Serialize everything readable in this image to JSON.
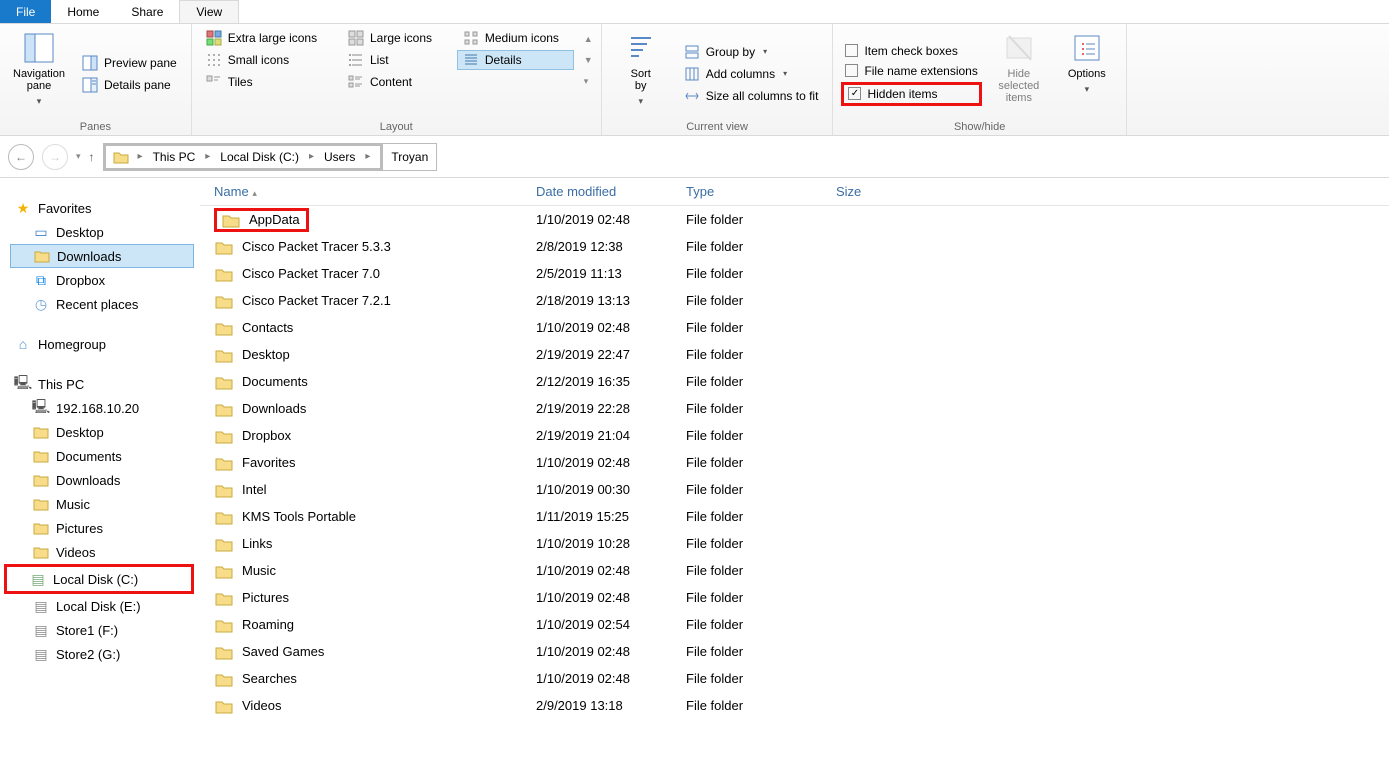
{
  "tabs": {
    "file": "File",
    "home": "Home",
    "share": "Share",
    "view": "View"
  },
  "ribbon": {
    "panes": {
      "nav": "Navigation\npane",
      "preview": "Preview pane",
      "details": "Details pane",
      "label": "Panes"
    },
    "layout": {
      "xl": "Extra large icons",
      "large": "Large icons",
      "medium": "Medium icons",
      "small": "Small icons",
      "list": "List",
      "details_item": "Details",
      "tiles": "Tiles",
      "content": "Content",
      "label": "Layout"
    },
    "current": {
      "sort": "Sort\nby",
      "group": "Group by",
      "addcols": "Add columns",
      "sizecols": "Size all columns to fit",
      "label": "Current view"
    },
    "showhide": {
      "itemchk": "Item check boxes",
      "ext": "File name extensions",
      "hidden": "Hidden items",
      "hidesel": "Hide selected\nitems",
      "options": "Options",
      "label": "Show/hide"
    }
  },
  "breadcrumb": {
    "pc": "This PC",
    "drive": "Local Disk (C:)",
    "users": "Users",
    "user": "Troyan"
  },
  "sidebar": {
    "favorites": "Favorites",
    "desktop": "Desktop",
    "downloads": "Downloads",
    "dropbox": "Dropbox",
    "recent": "Recent places",
    "homegroup": "Homegroup",
    "thispc": "This PC",
    "nas": "192.168.10.20",
    "desktop2": "Desktop",
    "documents": "Documents",
    "downloads2": "Downloads",
    "music": "Music",
    "pictures": "Pictures",
    "videos": "Videos",
    "c": "Local Disk (C:)",
    "e": "Local Disk (E:)",
    "f": "Store1 (F:)",
    "g": "Store2 (G:)"
  },
  "columns": {
    "name": "Name",
    "date": "Date modified",
    "type": "Type",
    "size": "Size"
  },
  "files": [
    {
      "name": "AppData",
      "date": "1/10/2019 02:48",
      "type": "File folder",
      "hl": true
    },
    {
      "name": "Cisco Packet Tracer 5.3.3",
      "date": "2/8/2019 12:38",
      "type": "File folder"
    },
    {
      "name": "Cisco Packet Tracer 7.0",
      "date": "2/5/2019 11:13",
      "type": "File folder"
    },
    {
      "name": "Cisco Packet Tracer 7.2.1",
      "date": "2/18/2019 13:13",
      "type": "File folder"
    },
    {
      "name": "Contacts",
      "date": "1/10/2019 02:48",
      "type": "File folder"
    },
    {
      "name": "Desktop",
      "date": "2/19/2019 22:47",
      "type": "File folder"
    },
    {
      "name": "Documents",
      "date": "2/12/2019 16:35",
      "type": "File folder"
    },
    {
      "name": "Downloads",
      "date": "2/19/2019 22:28",
      "type": "File folder"
    },
    {
      "name": "Dropbox",
      "date": "2/19/2019 21:04",
      "type": "File folder"
    },
    {
      "name": "Favorites",
      "date": "1/10/2019 02:48",
      "type": "File folder"
    },
    {
      "name": "Intel",
      "date": "1/10/2019 00:30",
      "type": "File folder"
    },
    {
      "name": "KMS Tools Portable",
      "date": "1/11/2019 15:25",
      "type": "File folder"
    },
    {
      "name": "Links",
      "date": "1/10/2019 10:28",
      "type": "File folder"
    },
    {
      "name": "Music",
      "date": "1/10/2019 02:48",
      "type": "File folder"
    },
    {
      "name": "Pictures",
      "date": "1/10/2019 02:48",
      "type": "File folder"
    },
    {
      "name": "Roaming",
      "date": "1/10/2019 02:54",
      "type": "File folder"
    },
    {
      "name": "Saved Games",
      "date": "1/10/2019 02:48",
      "type": "File folder"
    },
    {
      "name": "Searches",
      "date": "1/10/2019 02:48",
      "type": "File folder"
    },
    {
      "name": "Videos",
      "date": "2/9/2019 13:18",
      "type": "File folder"
    }
  ]
}
